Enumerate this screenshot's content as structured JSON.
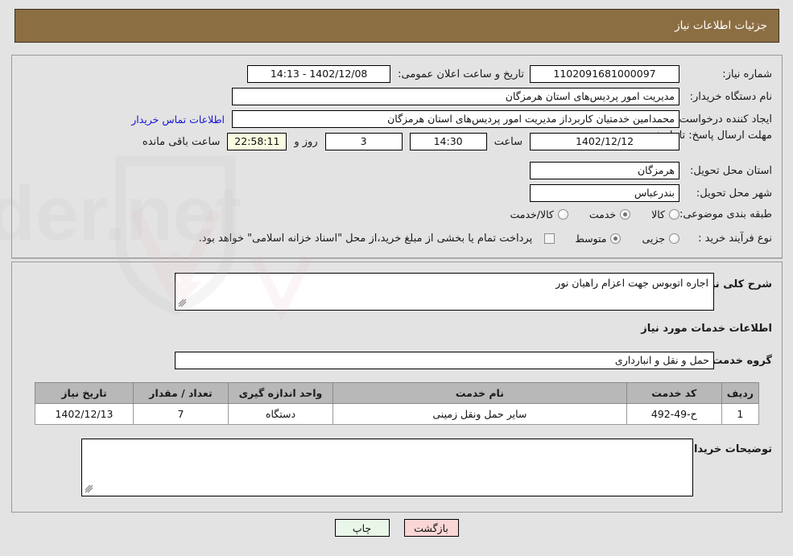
{
  "header": {
    "title": "جزئیات اطلاعات نیاز"
  },
  "watermark": {
    "text": "AriaTender.net"
  },
  "form": {
    "need_number": {
      "label": "شماره نیاز:",
      "value": "1102091681000097"
    },
    "announce": {
      "label": "تاریخ و ساعت اعلان عمومی:",
      "value": "1402/12/08 - 14:13"
    },
    "buyer_org": {
      "label": "نام دستگاه خریدار:",
      "value": "مدیریت امور پردیس‌های استان هرمزگان"
    },
    "creator": {
      "label": "ایجاد کننده درخواست:",
      "value": "محمدامین خدمتیان کاربرداز مدیریت امور پردیس‌های استان هرمزگان"
    },
    "contact_link": "اطلاعات تماس خریدار",
    "deadline": {
      "label": "مهلت ارسال پاسخ: تا تاریخ:",
      "date": "1402/12/12",
      "time_label": "ساعت",
      "time": "14:30",
      "days": "3",
      "days_label": "روز و",
      "countdown": "22:58:11",
      "remaining_label": "ساعت باقی مانده"
    },
    "province": {
      "label": "استان محل تحویل:",
      "value": "هرمزگان"
    },
    "city": {
      "label": "شهر محل تحویل:",
      "value": "بندرعباس"
    },
    "category": {
      "label": "طبقه بندی موضوعی:",
      "options": [
        {
          "label": "کالا",
          "selected": false
        },
        {
          "label": "خدمت",
          "selected": true
        },
        {
          "label": "کالا/خدمت",
          "selected": false
        }
      ]
    },
    "process": {
      "label": "نوع فرآیند خرید :",
      "options": [
        {
          "label": "جزیی",
          "selected": false
        },
        {
          "label": "متوسط",
          "selected": true
        }
      ],
      "note": "پرداخت تمام یا بخشی از مبلغ خرید،از محل \"اسناد خزانه اسلامی\" خواهد بود."
    }
  },
  "need_desc": {
    "label": "شرح کلی نیاز:",
    "value": "اجاره اتوبوس جهت اعزام راهیان نور"
  },
  "services_section": {
    "heading": "اطلاعات خدمات مورد نیاز",
    "group_label": "گروه خدمت:",
    "group_value": "حمل و نقل و انبارداری",
    "table": {
      "headers": [
        "ردیف",
        "کد خدمت",
        "نام خدمت",
        "واحد اندازه گیری",
        "تعداد / مقدار",
        "تاریخ نیاز"
      ],
      "rows": [
        {
          "row": "1",
          "code": "ح-49-492",
          "name": "سایر حمل ونقل زمینی",
          "unit": "دستگاه",
          "qty": "7",
          "date": "1402/12/13"
        }
      ]
    }
  },
  "buyer_notes": {
    "label": "توضیحات خریدار:",
    "value": ""
  },
  "buttons": {
    "print": "چاپ",
    "back": "بازگشت"
  },
  "colors": {
    "header_bg": "#8c6e43",
    "page_bg": "#e3e3e3",
    "link": "#1414d6",
    "table_header_bg": "#b8b8b8",
    "countdown_bg": "#fbfbe0",
    "print_bg": "#e9f7e9",
    "back_bg": "#fbd6d6"
  }
}
